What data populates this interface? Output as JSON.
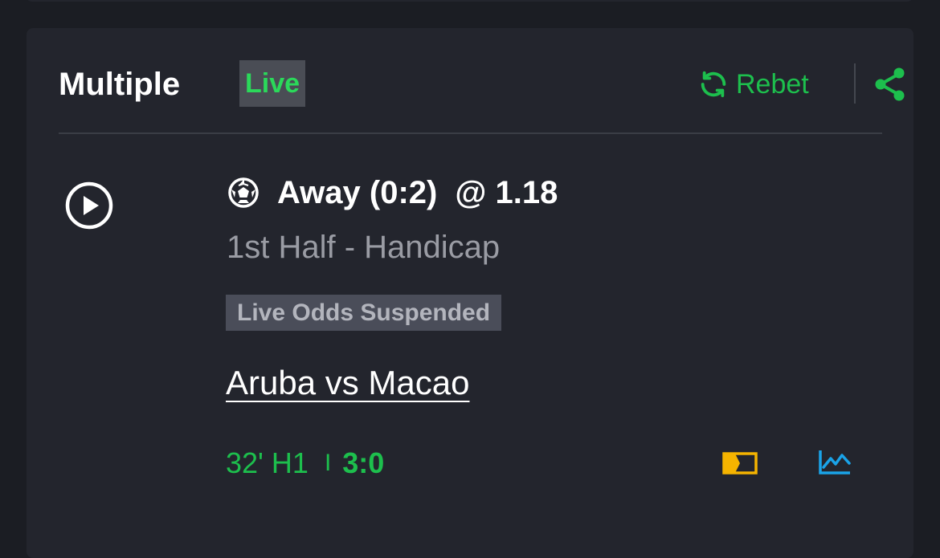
{
  "header": {
    "title": "Multiple",
    "live_badge": "Live",
    "rebet_label": "Rebet"
  },
  "bet": {
    "selection": "Away (0:2)",
    "odds": "@ 1.18",
    "market": "1st Half - Handicap",
    "status_badge": "Live Odds Suspended",
    "event": "Aruba vs Macao",
    "match_time": "32' H1",
    "separator": "I",
    "score": "3:0"
  },
  "icons": {
    "rebet": "refresh-icon",
    "share": "share-icon",
    "play": "play-icon",
    "sport": "soccer-ball-icon",
    "stream": "live-stream-icon",
    "stats": "stats-chart-icon"
  },
  "colors": {
    "background": "#1b1d23",
    "card": "#23252d",
    "accent_green": "#1dbf4d",
    "live_green": "#2bd95a",
    "stream_yellow": "#f5b400",
    "stats_blue": "#1aa3e8"
  }
}
